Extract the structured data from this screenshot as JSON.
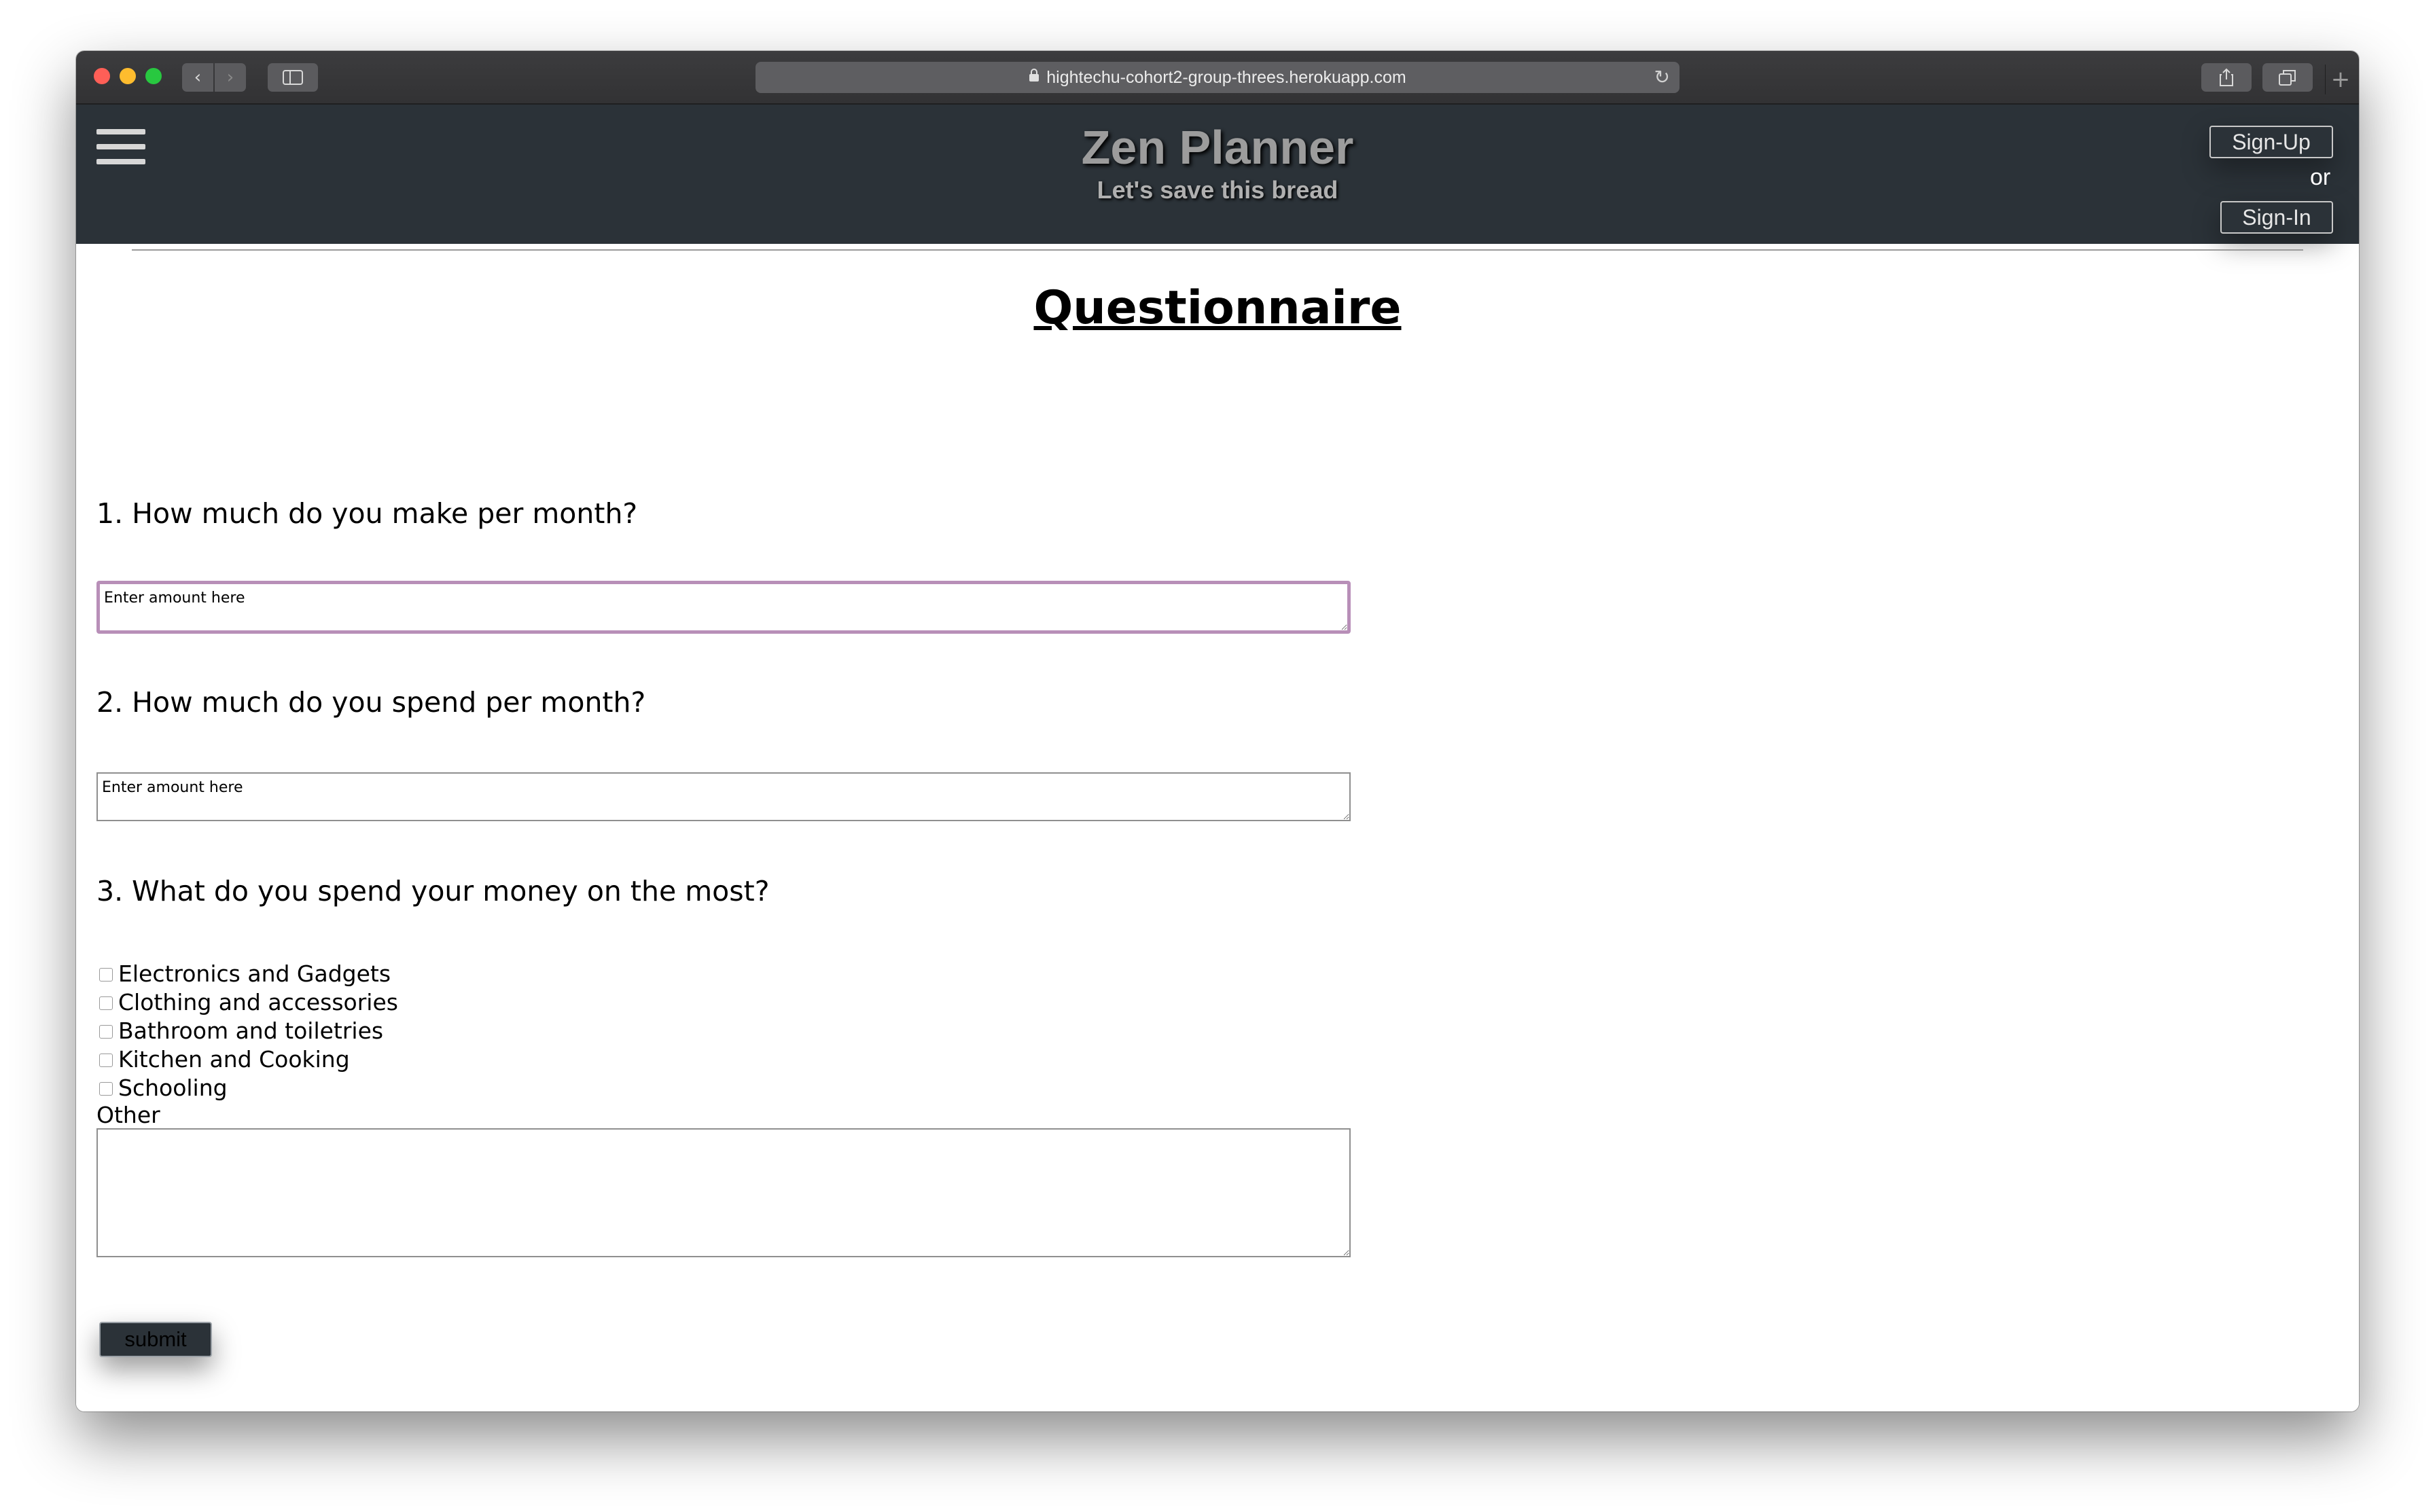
{
  "browser": {
    "url": "hightechu-cohort2-group-threes.herokuapp.com",
    "back_glyph": "‹",
    "forward_glyph": "›",
    "sidebar_glyph": "▯",
    "share_glyph": "⇪",
    "tabs_glyph": "⧉",
    "newtab_glyph": "+",
    "lock_glyph": "🔒",
    "reload_glyph": "↻"
  },
  "header": {
    "title": "Zen Planner",
    "subtitle": "Let's save this bread",
    "signup_label": "Sign-Up",
    "or_label": "or",
    "signin_label": "Sign-In",
    "background_color": "#2b3238"
  },
  "main": {
    "page_title": "Questionnaire",
    "q1": {
      "label": "1. How much do you make per month?",
      "placeholder": "Enter amount here",
      "value": ""
    },
    "q2": {
      "label": "2. How much do you spend per month?",
      "placeholder": "Enter amount here",
      "value": ""
    },
    "q3": {
      "label": "3. What do you spend your money on the most?",
      "options": [
        {
          "label": "Electronics and Gadgets",
          "checked": false
        },
        {
          "label": "Clothing and accessories",
          "checked": false
        },
        {
          "label": "Bathroom and toiletries",
          "checked": false
        },
        {
          "label": "Kitchen and Cooking",
          "checked": false
        },
        {
          "label": "Schooling",
          "checked": false
        }
      ],
      "other_label": "Other",
      "other_value": ""
    },
    "submit_label": "submit"
  }
}
